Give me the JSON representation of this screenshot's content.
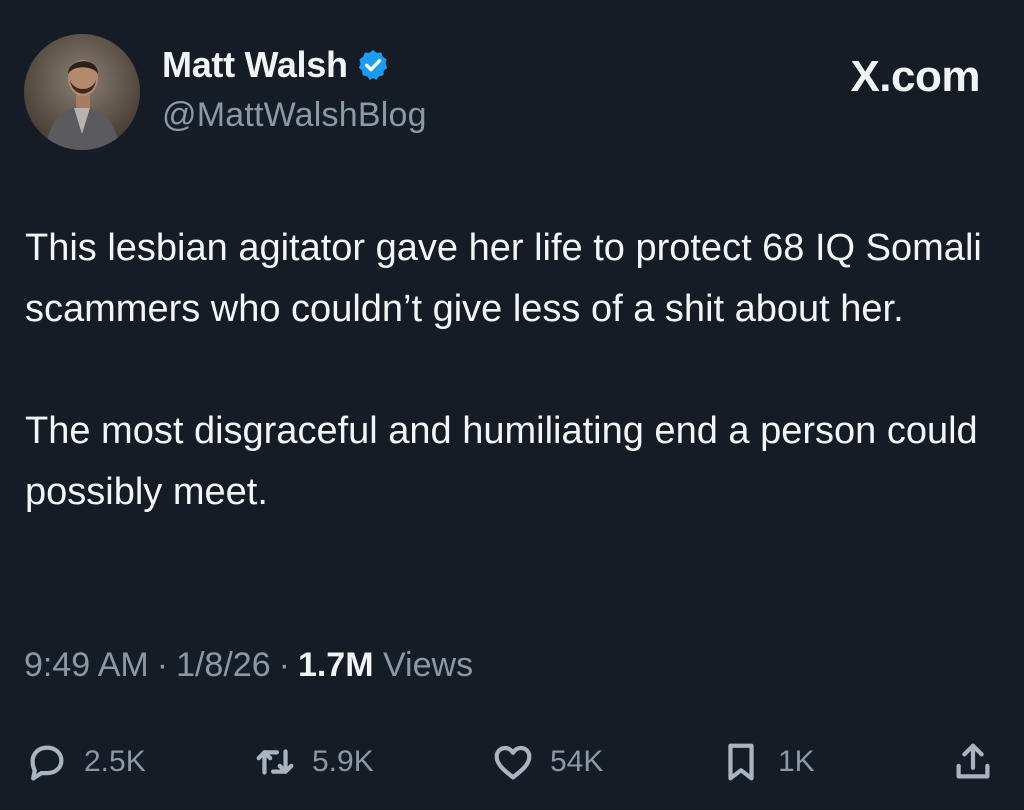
{
  "author": {
    "display_name": "Matt Walsh",
    "handle": "@MattWalshBlog",
    "verified_color": "#1d9bf0"
  },
  "brand": "X.com",
  "tweet": {
    "paragraphs": [
      "This lesbian agitator gave her life to protect 68 IQ Somali scammers who couldn’t give less of a shit about her.",
      "The most disgraceful and humiliating end a person could possibly meet."
    ]
  },
  "meta": {
    "time": "9:49 AM",
    "separator": "·",
    "date": "1/8/26",
    "views_count": "1.7M",
    "views_label": "Views"
  },
  "actions": {
    "replies": "2.5K",
    "reposts": "5.9K",
    "likes": "54K",
    "bookmarks": "1K"
  },
  "icons": {
    "reply": "reply-icon",
    "repost": "repost-icon",
    "like": "heart-icon",
    "bookmark": "bookmark-icon",
    "share": "share-icon",
    "verified": "verified-badge-icon"
  }
}
